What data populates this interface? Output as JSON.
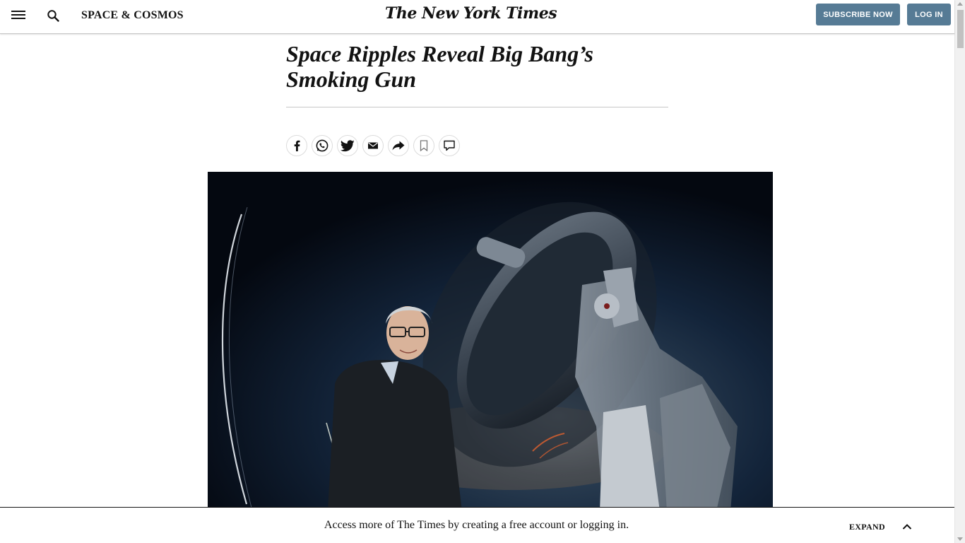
{
  "header": {
    "section_label": "SPACE & COSMOS",
    "logo_text": "The New York Times",
    "subscribe_label": "SUBSCRIBE NOW",
    "login_label": "LOG IN",
    "menu_icon": "hamburger-menu-icon",
    "search_icon": "search-icon"
  },
  "article": {
    "headline": "Space Ripples Reveal Big Bang’s Smoking Gun",
    "share_icons": [
      "facebook-icon",
      "whatsapp-icon",
      "twitter-icon",
      "email-icon",
      "share-icon",
      "bookmark-icon",
      "comment-icon"
    ]
  },
  "bottom_bar": {
    "message": "Access more of The Times by creating a free account or logging in.",
    "expand_label": "EXPAND",
    "expand_icon": "chevron-up-icon"
  },
  "colors": {
    "button_blue": "#567b95",
    "text": "#121212",
    "divider": "#c7c7c7"
  }
}
